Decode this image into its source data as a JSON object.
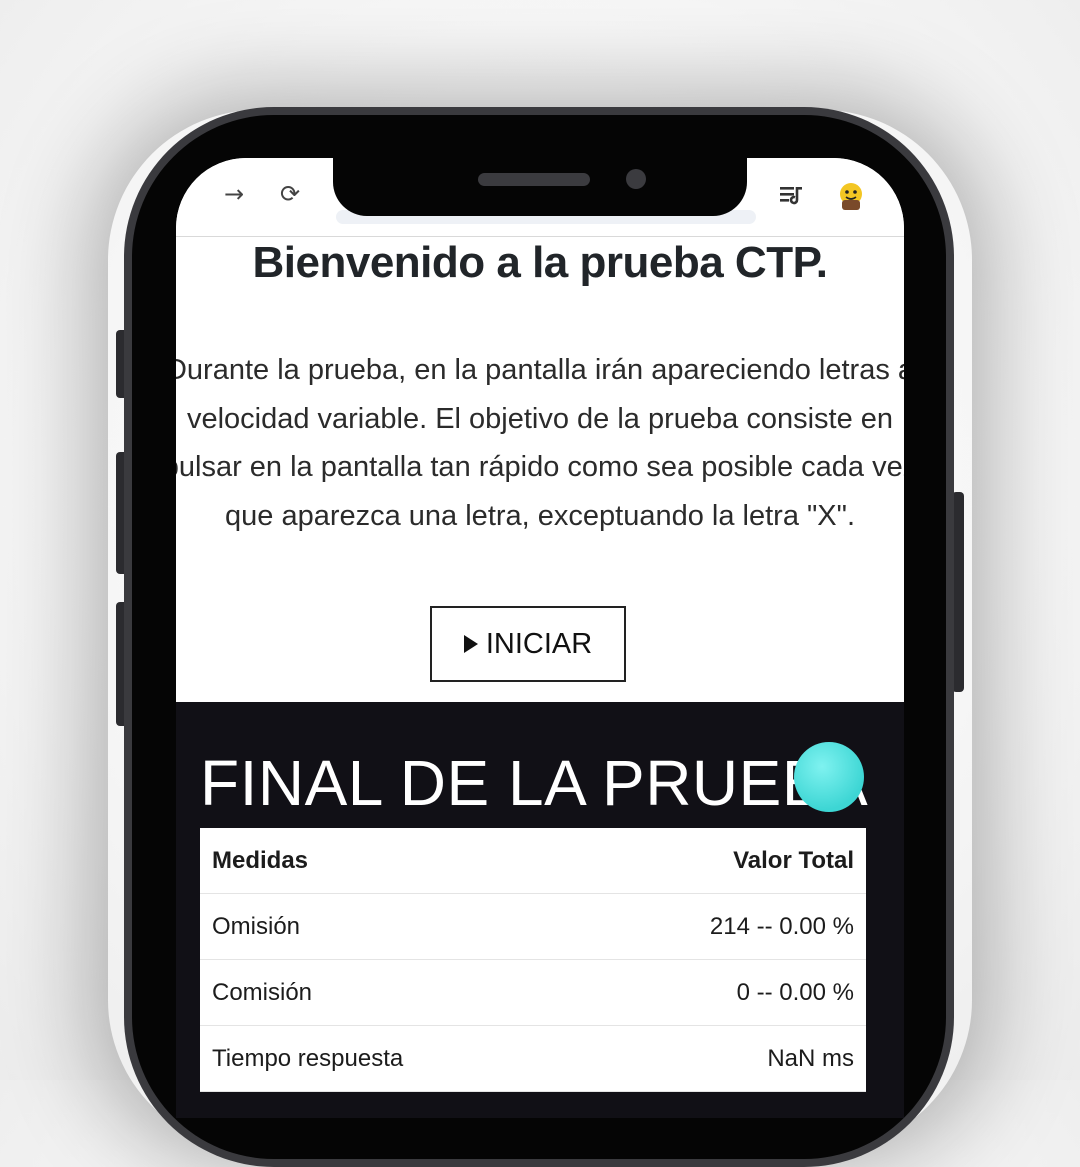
{
  "browser": {
    "back_icon": "back-arrow-icon",
    "forward_glyph": "→",
    "reload_glyph": "⟳"
  },
  "page": {
    "welcome_title": "Bienvenido a la prueba CTP.",
    "instructions": "Durante la prueba, en la pantalla irán apareciendo letras a velocidad variable. El objetivo de la prueba consiste en pulsar en la pantalla tan rápido como sea posible cada vez que aparezca una letra, exceptuando la letra \"X\".",
    "start_label": "INICIAR"
  },
  "results": {
    "title": "FINAL DE LA PRUEBA",
    "header": {
      "measure": "Medidas",
      "value": "Valor Total"
    },
    "rows": [
      {
        "measure": "Omisión",
        "value": "214 -- 0.00 %"
      },
      {
        "measure": "Comisión",
        "value": "0 -- 0.00 %"
      },
      {
        "measure": "Tiempo respuesta",
        "value": "NaN ms"
      }
    ]
  },
  "colors": {
    "results_bg": "#111016",
    "dot": "#3dd6d4"
  }
}
